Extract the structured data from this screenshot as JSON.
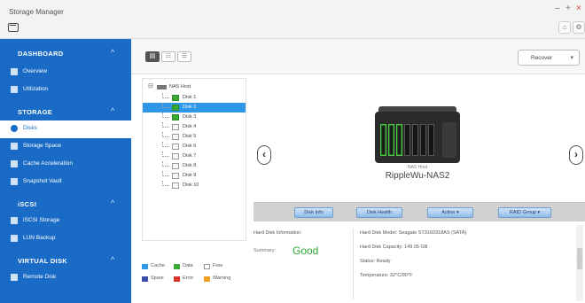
{
  "app": {
    "title": "Storage Manager",
    "minimize": "–",
    "maximize": "+",
    "close": "×"
  },
  "toolbar_icons": {
    "home": "⌂",
    "settings": "⚙",
    "help": "?"
  },
  "sidebar": {
    "sections": [
      {
        "label": "DASHBOARD",
        "items": [
          "Overview",
          "Utilization"
        ]
      },
      {
        "label": "STORAGE",
        "items": [
          "Disks",
          "Storage Space",
          "Cache Acceleration",
          "Snapshot Vault"
        ]
      },
      {
        "label": "iSCSI",
        "items": [
          "iSCSI Storage",
          "LUN Backup"
        ]
      },
      {
        "label": "VIRTUAL DISK",
        "items": [
          "Remote Disk"
        ]
      }
    ],
    "active_item": "Disks",
    "caret": "^"
  },
  "view_toggle": [
    "▤",
    "☷",
    "☰"
  ],
  "recover_button": "Recover",
  "tree": {
    "root": "NAS Host",
    "disks": [
      {
        "label": "Disk 1",
        "status": "good"
      },
      {
        "label": "Disk 2",
        "status": "good",
        "selected": true
      },
      {
        "label": "Disk 3",
        "status": "good"
      },
      {
        "label": "Disk 4",
        "status": "free"
      },
      {
        "label": "Disk 5",
        "status": "free"
      },
      {
        "label": "Disk 6",
        "status": "free"
      },
      {
        "label": "Disk 7",
        "status": "free"
      },
      {
        "label": "Disk 8",
        "status": "free"
      },
      {
        "label": "Disk 9",
        "status": "free"
      },
      {
        "label": "Disk 10",
        "status": "free"
      }
    ]
  },
  "legend": [
    {
      "label": "Cache",
      "color": "#2e97e8"
    },
    {
      "label": "Data",
      "color": "#3aa935"
    },
    {
      "label": "Free",
      "color": "#ffffff"
    },
    {
      "label": "Spare",
      "color": "#3b4ea8"
    },
    {
      "label": "Error",
      "color": "#d9342b"
    },
    {
      "label": "Warning",
      "color": "#f0a020"
    }
  ],
  "device": {
    "model": "NAS Host",
    "name": "RippleWu-NAS2"
  },
  "nav": {
    "prev": "‹",
    "next": "›"
  },
  "actions": [
    "Disk Info",
    "Disk Health",
    "Action ▾",
    "RAID Group ▾"
  ],
  "info": {
    "title": "Hard Disk Information",
    "summary_label": "Summary:",
    "summary_value": "Good",
    "details": [
      "Hard Disk Model: Seagate ST3160318AS (SATA)",
      "Hard Disk Capacity: 149.05 GB",
      "Status: Ready",
      "Temperature: 32°C/90°F"
    ]
  },
  "colors": {
    "sidebar": "#1a6bc6",
    "selection": "#2e97e8",
    "good": "#2aa830"
  }
}
